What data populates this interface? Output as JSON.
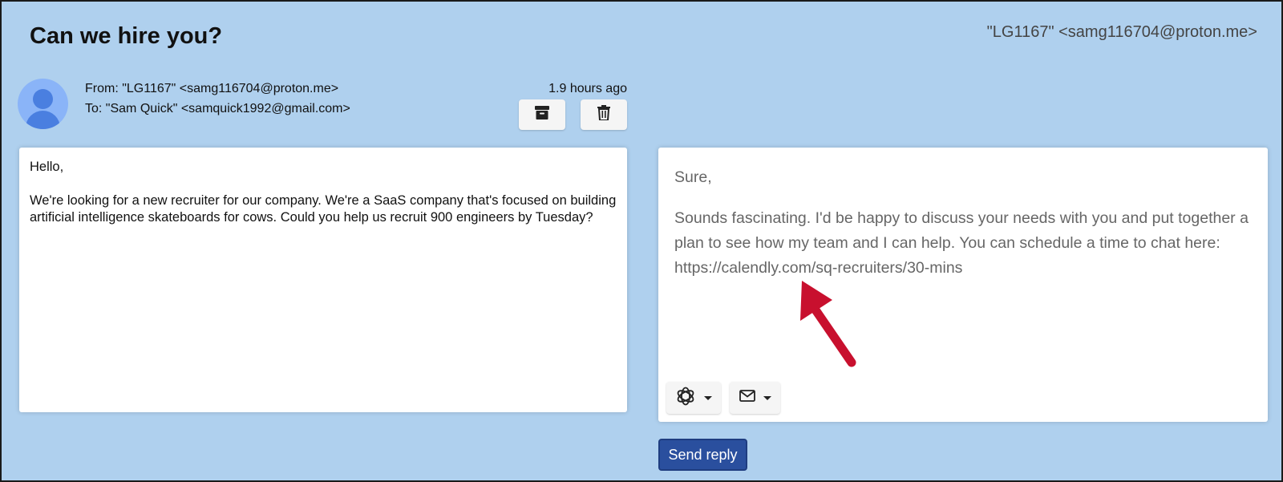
{
  "header": {
    "subject": "Can we hire you?",
    "sender_display": "\"LG1167\" <samg116704@proton.me>"
  },
  "email": {
    "from": "From: \"LG1167\" <samg116704@proton.me>",
    "to": "To: \"Sam Quick\" <samquick1992@gmail.com>",
    "time_ago": "1.9 hours ago",
    "body": [
      "Hello,",
      "We're looking for a new recruiter for our company. We're a SaaS company that's focused on building artificial intelligence skateboards for cows. Could you help us recruit 900 engineers by Tuesday?"
    ]
  },
  "actions": {
    "archive_icon": "archive-icon",
    "delete_icon": "trash-icon"
  },
  "reply": {
    "paragraphs": [
      "Sure,",
      "Sounds fascinating. I'd be happy to discuss your needs with you and put together a plan to see how my team and I can help. You can schedule a time to chat here: https://calendly.com/sq-recruiters/30-mins"
    ],
    "ai_icon": "openai-icon",
    "template_icon": "envelope-icon",
    "send_label": "Send reply"
  },
  "colors": {
    "background": "#afd0ee",
    "send_button": "#2a4f9e",
    "annotation_arrow": "#c8102e"
  }
}
